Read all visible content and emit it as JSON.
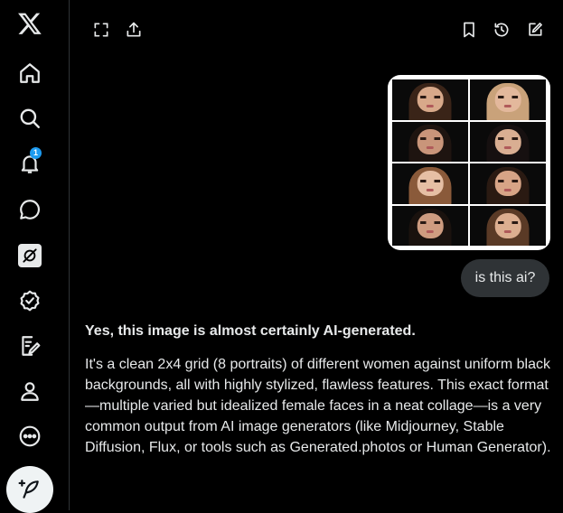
{
  "nav": {
    "notifications_badge": "1",
    "items": [
      "x-logo",
      "home",
      "explore",
      "notifications",
      "messages",
      "grok",
      "verified",
      "articles",
      "profile",
      "more"
    ]
  },
  "toolbar": {
    "left_icons": [
      "expand-icon",
      "share-icon"
    ],
    "right_icons": [
      "bookmark-icon",
      "history-icon",
      "new-chat-icon"
    ]
  },
  "conversation": {
    "attachment_caption": "",
    "user_message": "is this ai?",
    "response": {
      "heading": "Yes, this image is almost certainly AI-generated.",
      "body": "It's a clean 2x4 grid (8 portraits) of different women against uniform black backgrounds, all with highly stylized, flawless features. This exact format—multiple varied but idealized female faces in a neat collage—is a very common output from AI image generators (like Midjourney, Stable Diffusion, Flux, or tools such as Generated.photos or Human Generator)."
    }
  },
  "colors": {
    "background": "#000000",
    "text": "#e7e9ea",
    "border": "#2f3336",
    "accent": "#1d9bf0",
    "bubble": "#2f3336"
  }
}
